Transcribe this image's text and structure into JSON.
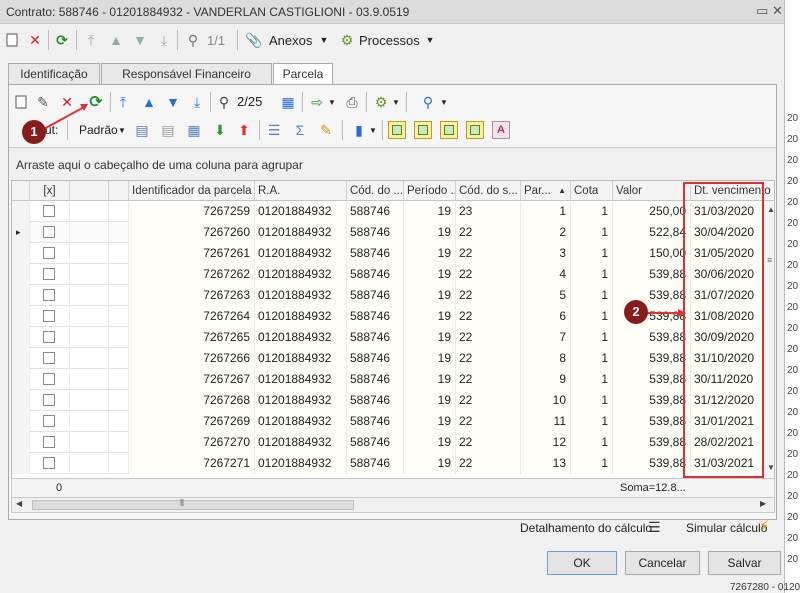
{
  "window": {
    "title": "Contrato: 588746 - 01201884932 - VANDERLAN CASTIGLIONI - 03.9.0519"
  },
  "toolbar_top": {
    "nav_position": "1/1",
    "anexos_label": "Anexos",
    "processos_label": "Processos"
  },
  "tabs": [
    {
      "label": "Identificação"
    },
    {
      "label": "Responsável Financeiro"
    },
    {
      "label": "Parcela"
    }
  ],
  "grid_toolbar": {
    "record_position": "2/25",
    "layout_label": "ut:",
    "layout_value": "Padrão"
  },
  "group_hint": "Arraste aqui o cabeçalho de uma coluna para agrupar",
  "columns": [
    {
      "label": "[x]"
    },
    {
      "label": ""
    },
    {
      "label": ""
    },
    {
      "label": "Identificador da parcela"
    },
    {
      "label": "R.A."
    },
    {
      "label": "Cód. do ..."
    },
    {
      "label": "Período ..."
    },
    {
      "label": "Cód. do s..."
    },
    {
      "label": "Par..."
    },
    {
      "label": "Cota"
    },
    {
      "label": "Valor"
    },
    {
      "label": "Dt. vencimento"
    }
  ],
  "rows": [
    {
      "id": "7267259",
      "ra": "01201884932",
      "cod": "588746",
      "periodo": "19",
      "codserv": "23",
      "parcela": "1",
      "cota": "1",
      "valor": "250,00",
      "vencimento": "31/03/2020"
    },
    {
      "id": "7267260",
      "ra": "01201884932",
      "cod": "588746",
      "periodo": "19",
      "codserv": "22",
      "parcela": "2",
      "cota": "1",
      "valor": "522,84",
      "vencimento": "30/04/2020"
    },
    {
      "id": "7267261",
      "ra": "01201884932",
      "cod": "588746",
      "periodo": "19",
      "codserv": "22",
      "parcela": "3",
      "cota": "1",
      "valor": "150,00",
      "vencimento": "31/05/2020"
    },
    {
      "id": "7267262",
      "ra": "01201884932",
      "cod": "588746",
      "periodo": "19",
      "codserv": "22",
      "parcela": "4",
      "cota": "1",
      "valor": "539,88",
      "vencimento": "30/06/2020"
    },
    {
      "id": "7267263",
      "ra": "01201884932",
      "cod": "588746",
      "periodo": "19",
      "codserv": "22",
      "parcela": "5",
      "cota": "1",
      "valor": "539,88",
      "vencimento": "31/07/2020"
    },
    {
      "id": "7267264",
      "ra": "01201884932",
      "cod": "588746",
      "periodo": "19",
      "codserv": "22",
      "parcela": "6",
      "cota": "1",
      "valor": "539,88",
      "vencimento": "31/08/2020"
    },
    {
      "id": "7267265",
      "ra": "01201884932",
      "cod": "588746",
      "periodo": "19",
      "codserv": "22",
      "parcela": "7",
      "cota": "1",
      "valor": "539,88",
      "vencimento": "30/09/2020"
    },
    {
      "id": "7267266",
      "ra": "01201884932",
      "cod": "588746",
      "periodo": "19",
      "codserv": "22",
      "parcela": "8",
      "cota": "1",
      "valor": "539,88",
      "vencimento": "31/10/2020"
    },
    {
      "id": "7267267",
      "ra": "01201884932",
      "cod": "588746",
      "periodo": "19",
      "codserv": "22",
      "parcela": "9",
      "cota": "1",
      "valor": "539,88",
      "vencimento": "30/11/2020"
    },
    {
      "id": "7267268",
      "ra": "01201884932",
      "cod": "588746",
      "periodo": "19",
      "codserv": "22",
      "parcela": "10",
      "cota": "1",
      "valor": "539,88",
      "vencimento": "31/12/2020"
    },
    {
      "id": "7267269",
      "ra": "01201884932",
      "cod": "588746",
      "periodo": "19",
      "codserv": "22",
      "parcela": "11",
      "cota": "1",
      "valor": "539,88",
      "vencimento": "31/01/2021"
    },
    {
      "id": "7267270",
      "ra": "01201884932",
      "cod": "588746",
      "periodo": "19",
      "codserv": "22",
      "parcela": "12",
      "cota": "1",
      "valor": "539,88",
      "vencimento": "28/02/2021"
    },
    {
      "id": "7267271",
      "ra": "01201884932",
      "cod": "588746",
      "periodo": "19",
      "codserv": "22",
      "parcela": "13",
      "cota": "1",
      "valor": "539,88",
      "vencimento": "31/03/2021"
    }
  ],
  "footer": {
    "count": "0",
    "sum": "Soma=12.8..."
  },
  "bottom": {
    "detalhamento": "Detalhamento do cálculo",
    "simular": "Simular cálculo"
  },
  "buttons": {
    "ok": "OK",
    "cancelar": "Cancelar",
    "salvar": "Salvar"
  },
  "annotations": {
    "marker1": "1",
    "marker2": "2"
  },
  "right_strip": [
    "20",
    "20",
    "20",
    "20",
    "20",
    "20",
    "20",
    "20",
    "20",
    "20",
    "20",
    "20",
    "20",
    "20",
    "20",
    "20",
    "20",
    "20",
    "20",
    "20",
    "20",
    "20"
  ],
  "right_strip_bottom": "7267280 - 0120",
  "colors": {
    "accent_red": "#e03030",
    "marker": "#8b1a1a",
    "yellow_button": "#fcef9a"
  }
}
